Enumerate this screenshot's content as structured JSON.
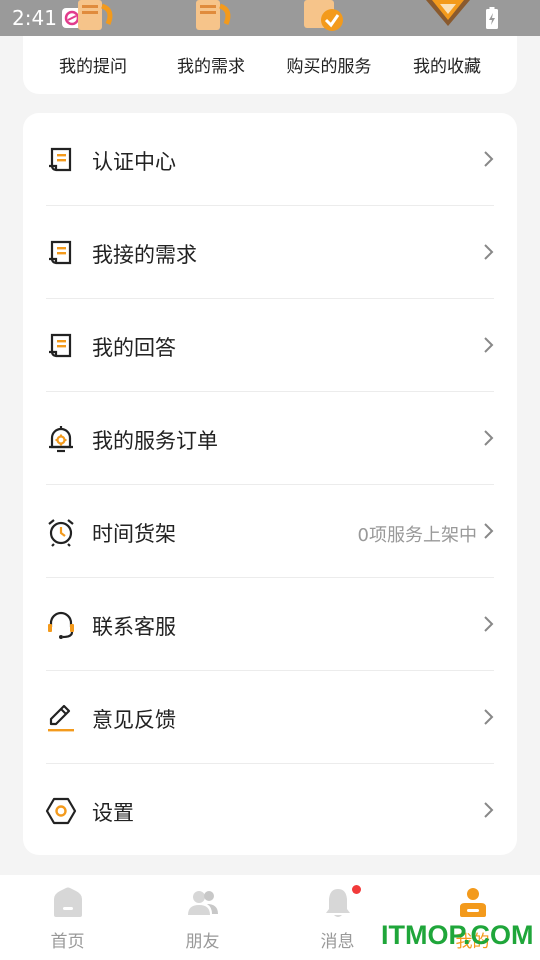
{
  "status_bar": {
    "time": "2:41"
  },
  "top_tabs": [
    {
      "label": "我的提问",
      "icon": "scroll-doc-icon"
    },
    {
      "label": "我的需求",
      "icon": "scroll-doc-icon"
    },
    {
      "label": "购买的服务",
      "icon": "scroll-check-icon"
    },
    {
      "label": "我的收藏",
      "icon": "heart-box-icon"
    }
  ],
  "menu": [
    {
      "label": "认证中心",
      "value": "",
      "icon": "document-icon"
    },
    {
      "label": "我接的需求",
      "value": "",
      "icon": "document-icon"
    },
    {
      "label": "我的回答",
      "value": "",
      "icon": "document-icon"
    },
    {
      "label": "我的服务订单",
      "value": "",
      "icon": "bell-gear-icon"
    },
    {
      "label": "时间货架",
      "value": "0项服务上架中",
      "icon": "alarm-clock-icon"
    },
    {
      "label": "联系客服",
      "value": "",
      "icon": "headset-icon"
    },
    {
      "label": "意见反馈",
      "value": "",
      "icon": "pencil-icon"
    },
    {
      "label": "设置",
      "value": "",
      "icon": "hexagon-settings-icon"
    }
  ],
  "bottom_nav": [
    {
      "label": "首页",
      "icon": "home-icon",
      "active": false
    },
    {
      "label": "朋友",
      "icon": "friends-icon",
      "active": false
    },
    {
      "label": "消息",
      "icon": "bell-icon",
      "active": false,
      "badge": true
    },
    {
      "label": "我的",
      "icon": "profile-icon",
      "active": true
    }
  ],
  "watermark": "ITMOP.COM",
  "colors": {
    "accent": "#f39a1c",
    "text": "#222222",
    "muted": "#999999",
    "badge": "#f23a3a",
    "watermark": "#1fa63a"
  }
}
